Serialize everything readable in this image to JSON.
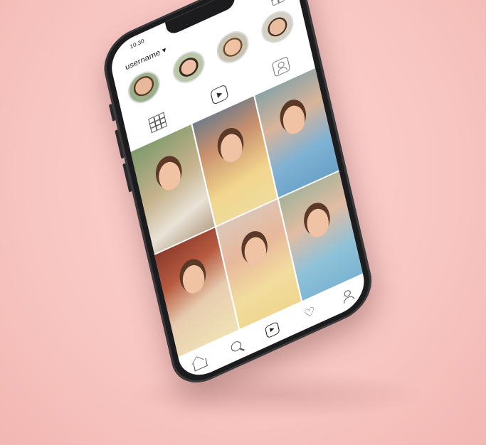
{
  "status_bar": {
    "time": "10:30"
  },
  "profile": {
    "username": "username ▾"
  },
  "stories": [
    {
      "icon": "story-avatar"
    },
    {
      "icon": "story-avatar"
    },
    {
      "icon": "story-avatar"
    },
    {
      "icon": "story-avatar"
    }
  ],
  "tabs": [
    {
      "icon": "grid-icon"
    },
    {
      "icon": "reels-icon",
      "active": true
    },
    {
      "icon": "tagged-icon"
    }
  ],
  "bottom_nav": [
    {
      "icon": "home-icon"
    },
    {
      "icon": "search-icon"
    },
    {
      "icon": "reels-icon",
      "active": true
    },
    {
      "icon": "heart-icon"
    },
    {
      "icon": "profile-icon"
    }
  ],
  "colors": {
    "background": "#f8c6c2",
    "phone_frame": "#1c1c1e",
    "screen": "#ffffff"
  }
}
